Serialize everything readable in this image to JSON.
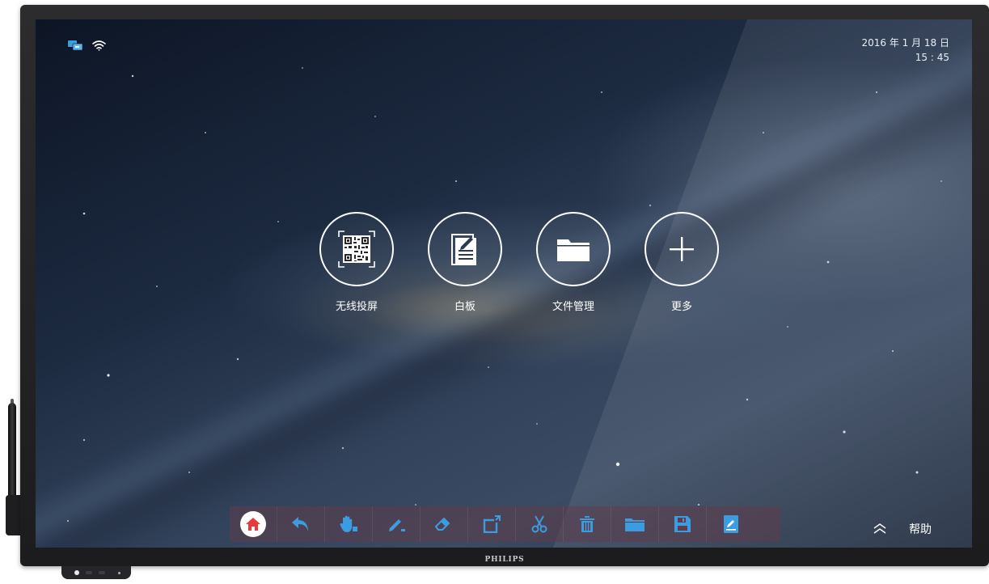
{
  "device": {
    "brand": "PHILIPS"
  },
  "status_bar": {
    "date": "2016 年 1 月 18 日",
    "time": "15 : 45",
    "icons": [
      "screen-share-icon",
      "wifi-icon"
    ]
  },
  "apps": [
    {
      "label": "无线投屏",
      "icon": "qr-code-icon"
    },
    {
      "label": "白板",
      "icon": "whiteboard-icon"
    },
    {
      "label": "文件管理",
      "icon": "folder-icon"
    },
    {
      "label": "更多",
      "icon": "plus-icon"
    }
  ],
  "toolbar": {
    "tools": [
      "home-icon",
      "undo-icon",
      "hand-icon",
      "pen-icon",
      "eraser-icon",
      "crop-icon",
      "scissors-icon",
      "trash-icon",
      "folder-icon",
      "save-icon",
      "note-icon"
    ],
    "accent_color": "#3b9de0",
    "home_color": "#e63b3b"
  },
  "help": {
    "label": "帮助",
    "icon": "double-chevron-up-icon"
  }
}
